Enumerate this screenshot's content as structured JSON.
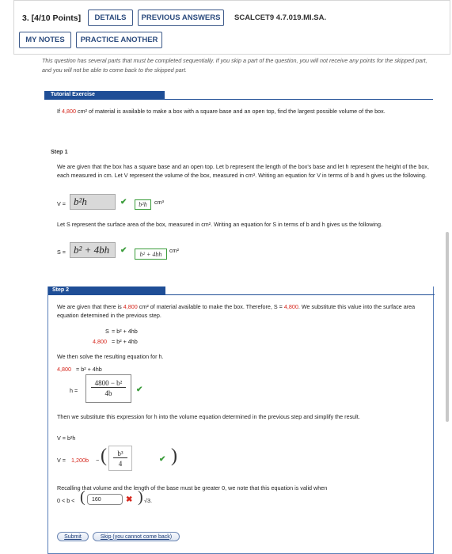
{
  "header": {
    "qnum": "3. [4/10 Points]",
    "details": "DETAILS",
    "previous_answers": "PREVIOUS ANSWERS",
    "code": "SCALCET9 4.7.019.MI.SA.",
    "my_notes": "MY NOTES",
    "practice_another": "PRACTICE ANOTHER"
  },
  "intro": "This question has several parts that must be completed sequentially. If you skip a part of the question, you will not receive any points for the skipped part, and you will not be able to come back to the skipped part.",
  "tutorial": {
    "label": "Tutorial Exercise",
    "p_if": "If",
    "area_value": "4,800",
    "p_rest": "cm² of material is available to make a box with a square base and an open top, find the largest possible volume of the box."
  },
  "step1": {
    "label": "Step 1",
    "para1": "We are given that the box has a square base and an open top. Let b represent the length of the box's base and let h represent the height of the box, each measured in cm. Let V represent the volume of the box, measured in cm³. Writing an equation for V in terms of b and h gives us the following.",
    "v_eq": "V =",
    "v_answer": "b²h",
    "v_correct": "b²h",
    "v_unit": "cm³",
    "para2": "Let S represent the surface area of the box, measured in cm². Writing an equation for S in terms of b and h gives us the following.",
    "s_eq": "S =",
    "s_answer": "b² + 4bh",
    "s_correct": "b² + 4bh",
    "s_unit": "cm²"
  },
  "step2": {
    "label": "Step 2",
    "p1a": "We are given that there is",
    "p1_area": "4,800",
    "p1b": "cm² of material available to make the box. Therefore, S =",
    "p1_area2": "4,800",
    "p1c": ". We substitute this value into the surface area equation determined in the previous step.",
    "eq1_lhs": "S",
    "eq1_rhs": "= b² + 4hb",
    "eq2_lhs": "4,800",
    "eq2_rhs": "= b² + 4hb",
    "p2": "We then solve the resulting equation for h.",
    "eq3_lhs": "4,800",
    "eq3_rhs": "= b² + 4hb",
    "h_eq": "h =",
    "h_num": "4800 − b²",
    "h_den": "4b",
    "p3": "Then we substitute this expression for h into the volume equation determined in the previous step and simplify the result.",
    "v_eq": "V = b²h",
    "v2_lhs": "V =",
    "v2_coef": "1,200b",
    "v2_minus": "−",
    "v2_num": "b³",
    "v2_den": "4",
    "p4": "Recalling that volume and the length of the base must be greater 0, we note that this equation is valid when",
    "ineq_prefix": "0 < b <",
    "ineq_value": "160",
    "ineq_suffix": "√3.",
    "submit": "Submit",
    "skip": "Skip (you cannot come back)"
  },
  "colors": {
    "accent": "#1f4e96",
    "red": "#d6261c",
    "green": "#3a9c3a"
  }
}
